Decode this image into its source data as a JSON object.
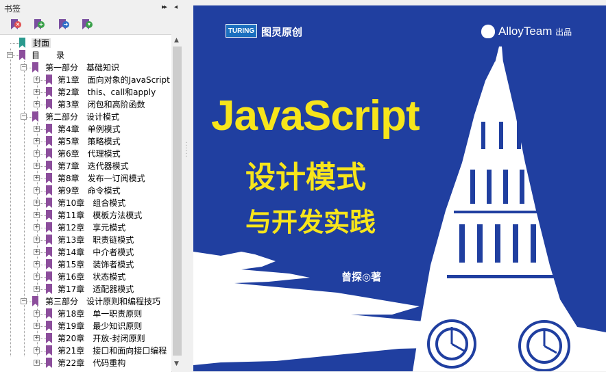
{
  "panel": {
    "title": "书签",
    "pin_glyph": "▸▸",
    "collapse_glyph": "◂",
    "toolbar": [
      {
        "icon": "delete-bookmark-icon",
        "badge": "×",
        "color": "#e05050"
      },
      {
        "icon": "add-bookmark-icon",
        "badge": "+",
        "color": "#3aa04a"
      },
      {
        "icon": "go-to-bookmark-icon",
        "badge": "➜",
        "color": "#2f6fc8"
      },
      {
        "icon": "expand-bookmark-icon",
        "badge": "▾",
        "color": "#3aa04a"
      }
    ]
  },
  "bookmarks": [
    {
      "level": 0,
      "label": "封面",
      "expander": "",
      "bookmark_color": "teal",
      "selected": true
    },
    {
      "level": 0,
      "label": "目　　录",
      "expander": "−",
      "bookmark_color": "purple"
    },
    {
      "level": 1,
      "label": "第一部分　基础知识",
      "expander": "−",
      "bookmark_color": "purple"
    },
    {
      "level": 2,
      "label": "第1章　面向对象的JavaScript",
      "expander": "+",
      "bookmark_color": "purple"
    },
    {
      "level": 2,
      "label": "第2章　this、call和apply",
      "expander": "+",
      "bookmark_color": "purple"
    },
    {
      "level": 2,
      "label": "第3章　闭包和高阶函数",
      "expander": "+",
      "bookmark_color": "purple"
    },
    {
      "level": 1,
      "label": "第二部分　设计模式",
      "expander": "−",
      "bookmark_color": "purple"
    },
    {
      "level": 2,
      "label": "第4章　单例模式",
      "expander": "+",
      "bookmark_color": "purple"
    },
    {
      "level": 2,
      "label": "第5章　策略模式",
      "expander": "+",
      "bookmark_color": "purple"
    },
    {
      "level": 2,
      "label": "第6章　代理模式",
      "expander": "+",
      "bookmark_color": "purple"
    },
    {
      "level": 2,
      "label": "第7章　迭代器模式",
      "expander": "+",
      "bookmark_color": "purple"
    },
    {
      "level": 2,
      "label": "第8章　发布—订阅模式",
      "expander": "+",
      "bookmark_color": "purple"
    },
    {
      "level": 2,
      "label": "第9章　命令模式",
      "expander": "+",
      "bookmark_color": "purple"
    },
    {
      "level": 2,
      "label": "第10章　组合模式",
      "expander": "+",
      "bookmark_color": "purple"
    },
    {
      "level": 2,
      "label": "第11章　模板方法模式",
      "expander": "+",
      "bookmark_color": "purple"
    },
    {
      "level": 2,
      "label": "第12章　享元模式",
      "expander": "+",
      "bookmark_color": "purple"
    },
    {
      "level": 2,
      "label": "第13章　职责链模式",
      "expander": "+",
      "bookmark_color": "purple"
    },
    {
      "level": 2,
      "label": "第14章　中介者模式",
      "expander": "+",
      "bookmark_color": "purple"
    },
    {
      "level": 2,
      "label": "第15章　装饰者模式",
      "expander": "+",
      "bookmark_color": "purple"
    },
    {
      "level": 2,
      "label": "第16章　状态模式",
      "expander": "+",
      "bookmark_color": "purple"
    },
    {
      "level": 2,
      "label": "第17章　适配器模式",
      "expander": "+",
      "bookmark_color": "purple"
    },
    {
      "level": 1,
      "label": "第三部分　设计原则和编程技巧",
      "expander": "−",
      "bookmark_color": "purple"
    },
    {
      "level": 2,
      "label": "第18章　单一职责原则",
      "expander": "+",
      "bookmark_color": "purple"
    },
    {
      "level": 2,
      "label": "第19章　最少知识原则",
      "expander": "+",
      "bookmark_color": "purple"
    },
    {
      "level": 2,
      "label": "第20章　开放-封闭原则",
      "expander": "+",
      "bookmark_color": "purple"
    },
    {
      "level": 2,
      "label": "第21章　接口和面向接口编程",
      "expander": "+",
      "bookmark_color": "purple"
    },
    {
      "level": 2,
      "label": "第22章　代码重构",
      "expander": "+",
      "bookmark_color": "purple"
    }
  ],
  "scrollbar": {
    "up": "▲",
    "down": "▼"
  },
  "cover": {
    "publisher_logo": "TURING",
    "publisher_name": "图灵原创",
    "team": "AlloyTeam",
    "team_suffix": "出品",
    "title_en": "JavaScript",
    "title_cn_line1": "设计模式",
    "title_cn_line2": "与开发实践",
    "author": "曾探◎著",
    "colors": {
      "background": "#203fa0",
      "title": "#f7e51b",
      "text": "#ffffff"
    }
  }
}
